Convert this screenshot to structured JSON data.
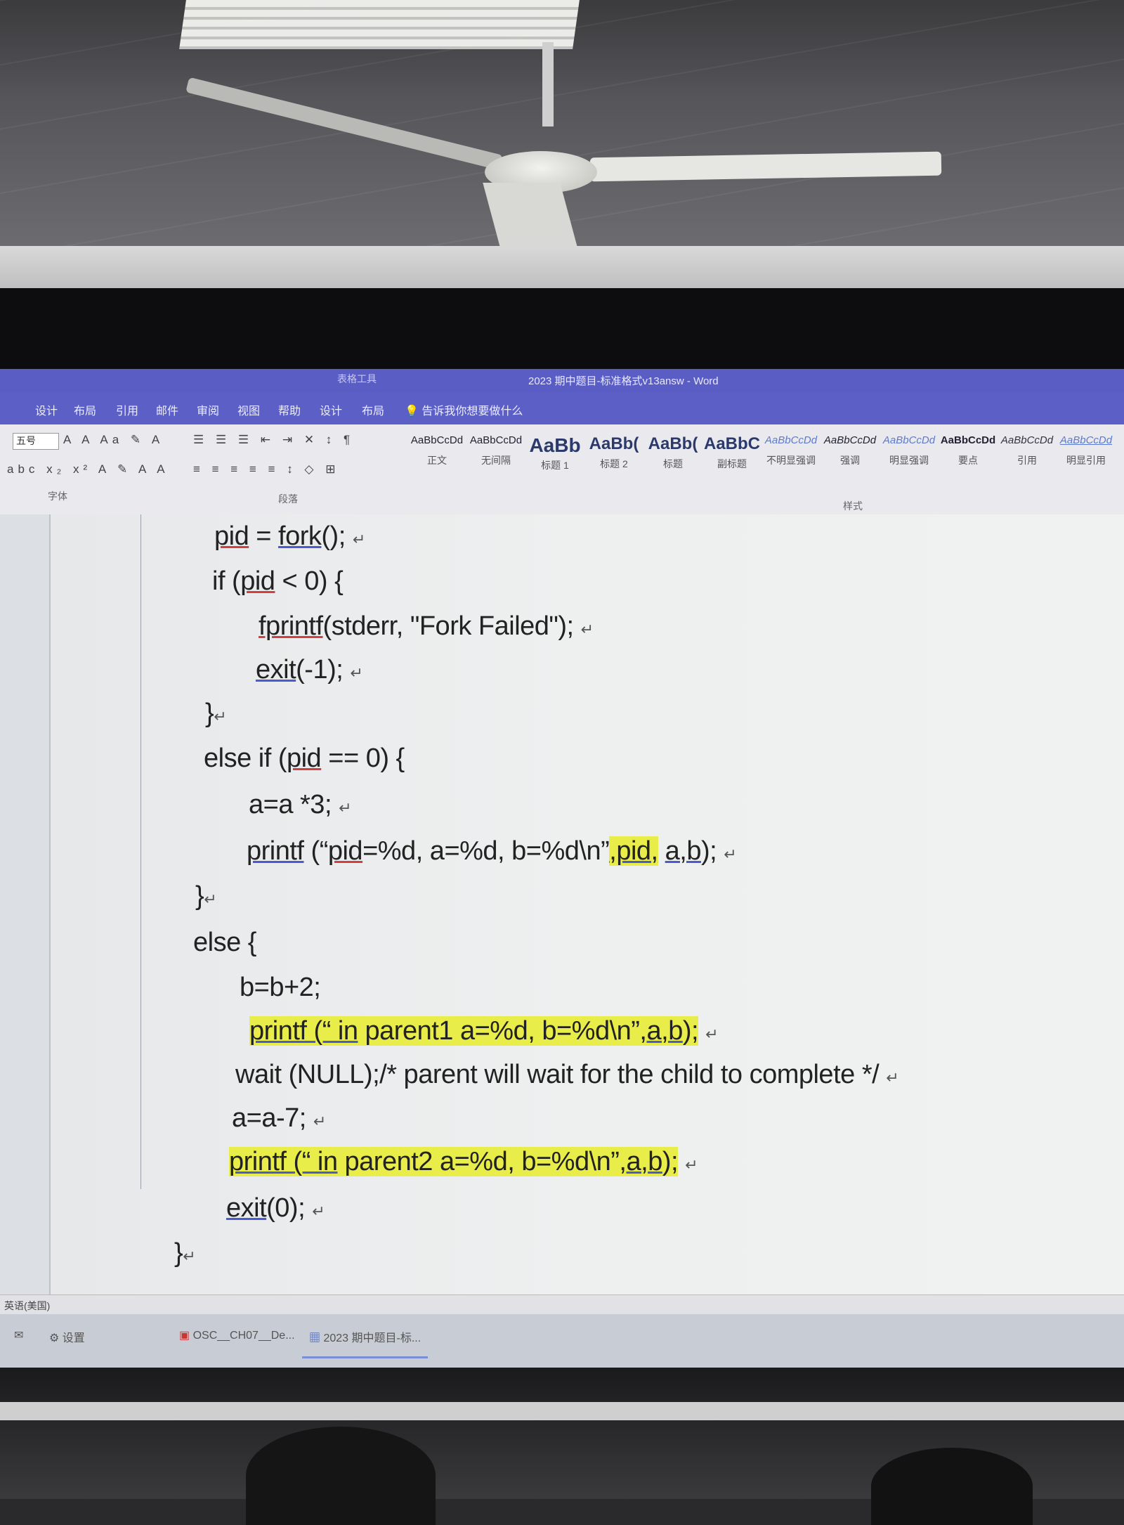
{
  "window": {
    "context_tab": "表格工具",
    "title": "2023 期中题目-标准格式v13answ - Word"
  },
  "menu": [
    "设计",
    "布局",
    "引用",
    "邮件",
    "审阅",
    "视图",
    "帮助",
    "设计",
    "布局"
  ],
  "tell_me": "告诉我你想要做什么",
  "ribbon": {
    "font_size": "五号",
    "font_group_label": "字体",
    "paragraph_group_label": "段落",
    "styles_group_label": "样式",
    "styles": [
      {
        "preview": "AaBbCcDd",
        "name": "正文"
      },
      {
        "preview": "AaBbCcDd",
        "name": "无间隔"
      },
      {
        "preview": "AaBb",
        "name": "标题 1"
      },
      {
        "preview": "AaBb(",
        "name": "标题 2"
      },
      {
        "preview": "AaBb(",
        "name": "标题"
      },
      {
        "preview": "AaBbC",
        "name": "副标题"
      },
      {
        "preview": "AaBbCcDd",
        "name": "不明显强调"
      },
      {
        "preview": "AaBbCcDd",
        "name": "强调"
      },
      {
        "preview": "AaBbCcDd",
        "name": "明显强调"
      },
      {
        "preview": "AaBbCcDd",
        "name": "要点"
      },
      {
        "preview": "AaBbCcDd",
        "name": "引用"
      },
      {
        "preview": "AaBbCcDd",
        "name": "明显引用"
      }
    ]
  },
  "code": {
    "l1a": "pid",
    "l1b": " = ",
    "l1c": "fork",
    "l1d": "();",
    "l2a": "if (",
    "l2b": "pid",
    "l2c": " < 0) {",
    "l3a": "fprintf",
    "l3b": "(stderr, \"Fork Failed\");",
    "l4a": "exit",
    "l4b": "(-1);",
    "l5": "}",
    "l6a": "else if (",
    "l6b": "pid",
    "l6c": " == 0) {",
    "l7": "a=a *3;",
    "l8a": "printf",
    "l8b": " (“",
    "l8c": "pid",
    "l8d": "=%d, a=%d, b=%d\\n”",
    "l8e": ",pid,",
    "l8f": " ",
    "l8g": "a,b",
    "l8h": ");",
    "l9": "}",
    "l10": "else {",
    "l11": "b=b+2;",
    "l12a": "printf",
    "l12b": " (“ in",
    "l12c": " parent1 a=%d, b=%d\\n”,",
    "l12d": "a,b",
    "l12e": ");",
    "l13": "wait (NULL);/* parent will wait for the child to complete */",
    "l14": "a=a-7;",
    "l15a": "printf",
    "l15b": " (“ in",
    "l15c": " parent2 a=%d, b=%d\\n”,",
    "l15d": "a,b",
    "l15e": ");",
    "l16a": "exit",
    "l16b": "(0);",
    "l17": "}"
  },
  "statusbar": {
    "language": "英语(美国)"
  },
  "taskbar": {
    "items": [
      "设置",
      "OSC__CH07__De...",
      "2023 期中题目-标..."
    ]
  }
}
